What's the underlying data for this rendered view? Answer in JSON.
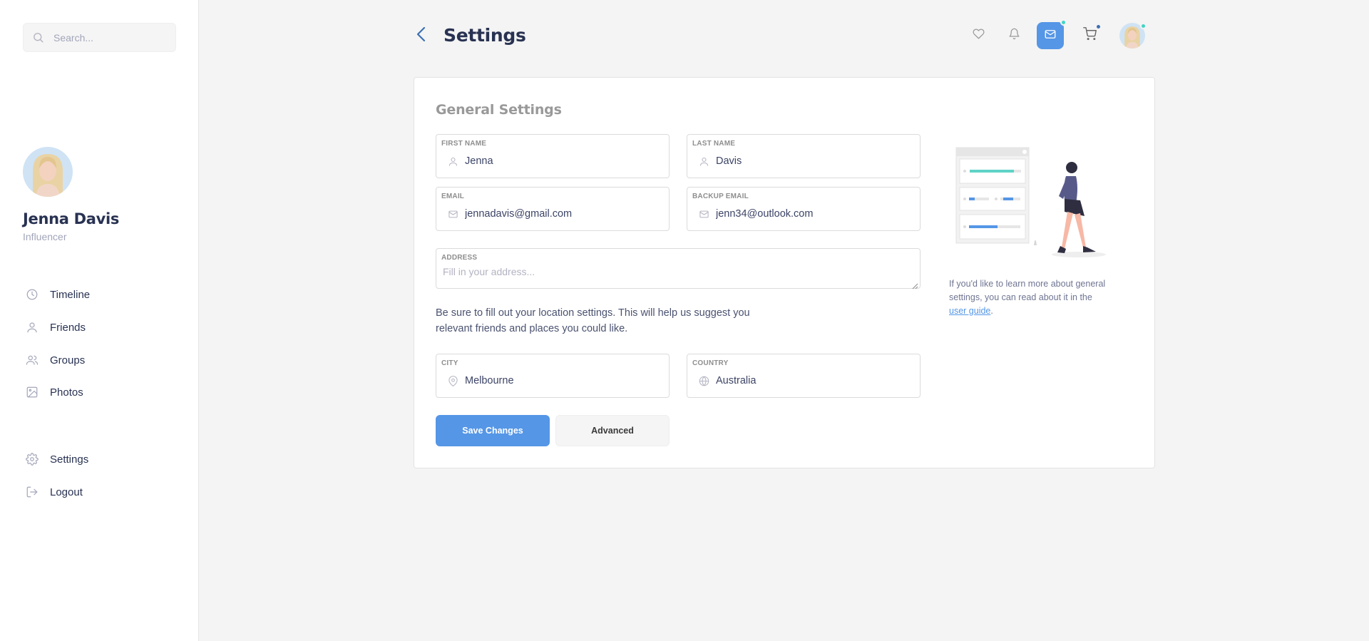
{
  "search": {
    "placeholder": "Search..."
  },
  "profile": {
    "name": "Jenna Davis",
    "role": "Influencer"
  },
  "nav": {
    "items": [
      {
        "label": "Timeline",
        "icon": "clock-icon"
      },
      {
        "label": "Friends",
        "icon": "user-icon"
      },
      {
        "label": "Groups",
        "icon": "users-icon"
      },
      {
        "label": "Photos",
        "icon": "image-icon"
      }
    ],
    "bottom": [
      {
        "label": "Settings",
        "icon": "gear-icon"
      },
      {
        "label": "Logout",
        "icon": "logout-icon"
      }
    ]
  },
  "header": {
    "title": "Settings",
    "icons": [
      "heart-icon",
      "bell-icon",
      "mail-icon",
      "cart-icon"
    ]
  },
  "colors": {
    "accent": "#5596e6",
    "notify_green": "#41d6c3",
    "notify_blue": "#3d70b2"
  },
  "card": {
    "title": "General Settings",
    "fields": {
      "first_name": {
        "label": "FIRST NAME",
        "value": "Jenna"
      },
      "last_name": {
        "label": "LAST NAME",
        "value": "Davis"
      },
      "email": {
        "label": "EMAIL",
        "value": "jennadavis@gmail.com"
      },
      "backup_email": {
        "label": "BACKUP EMAIL",
        "value": "jenn34@outlook.com"
      },
      "address": {
        "label": "ADDRESS",
        "placeholder": "Fill in your address..."
      },
      "city": {
        "label": "CITY",
        "value": "Melbourne"
      },
      "country": {
        "label": "COUNTRY",
        "value": "Australia"
      }
    },
    "help_text": "Be sure to fill out your location settings. This will help us suggest you relevant friends and places you could like.",
    "save_label": "Save Changes",
    "advanced_label": "Advanced",
    "side_note": {
      "prefix": "If you'd like to learn more about general settings, you can read about it in the ",
      "link": "user guide",
      "suffix": "."
    }
  }
}
